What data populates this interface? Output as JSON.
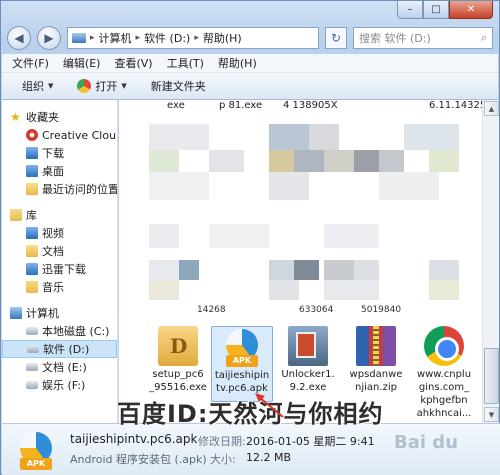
{
  "window": {
    "controls": {
      "minimize": "–",
      "maximize": "□",
      "close": "✕"
    }
  },
  "address": {
    "back_icon": "back-arrow-icon",
    "forward_icon": "forward-arrow-icon",
    "crumbs": [
      "计算机",
      "软件 (D:)",
      "帮助(H)"
    ],
    "search_placeholder": "搜索 软件 (D:)"
  },
  "menu": [
    "文件(F)",
    "编辑(E)",
    "查看(V)",
    "工具(T)",
    "帮助(H)"
  ],
  "commands": {
    "organize": "组织",
    "open": "打开",
    "new_folder": "新建文件夹"
  },
  "nav": {
    "favorites": {
      "label": "收藏夹",
      "items": [
        "Creative Clou",
        "下载",
        "桌面",
        "最近访问的位置"
      ]
    },
    "libraries": {
      "label": "库",
      "items": [
        "视频",
        "文档",
        "迅雷下载",
        "音乐"
      ]
    },
    "computer": {
      "label": "计算机",
      "items": [
        "本地磁盘 (C:)",
        "软件 (D:)",
        "文档 (E:)",
        "娱乐 (F:)"
      ]
    }
  },
  "content": {
    "top_labels": [
      "exe",
      "p 81.exe",
      "4 138905X",
      "6.11.14325"
    ],
    "caption_labels": [
      "14268",
      "633064",
      "5019840"
    ],
    "files": [
      {
        "name": "setup_pc6\n_95516.exe",
        "icon": "installer-icon"
      },
      {
        "name": "taijieshipin\ntv.pc6.apk",
        "icon": "apk-icon",
        "selected": true
      },
      {
        "name": "Unlocker1.\n9.2.exe",
        "icon": "unlocker-icon"
      },
      {
        "name": "wpsdanwe\nnjian.zip",
        "icon": "winrar-icon"
      },
      {
        "name": "www.cnplu\ngins.com_\nkphgefbn\nahkhncai...",
        "icon": "chrome-icon"
      }
    ]
  },
  "details": {
    "name": "taijieshipintv.pc6.apk",
    "type": "Android 程序安装包 (.apk)",
    "modified_label": "修改日期:",
    "modified_value": "2016-01-05 星期二 9:41",
    "size_label": "大小:",
    "size_value": "12.2 MB"
  },
  "overlay": {
    "watermark": "百度ID:天然河与你相约",
    "site_logo": "Bai du"
  },
  "colors": {
    "accent": "#3a6aa8",
    "selection": "#d9ebfa",
    "arrow": "#e0322a"
  }
}
